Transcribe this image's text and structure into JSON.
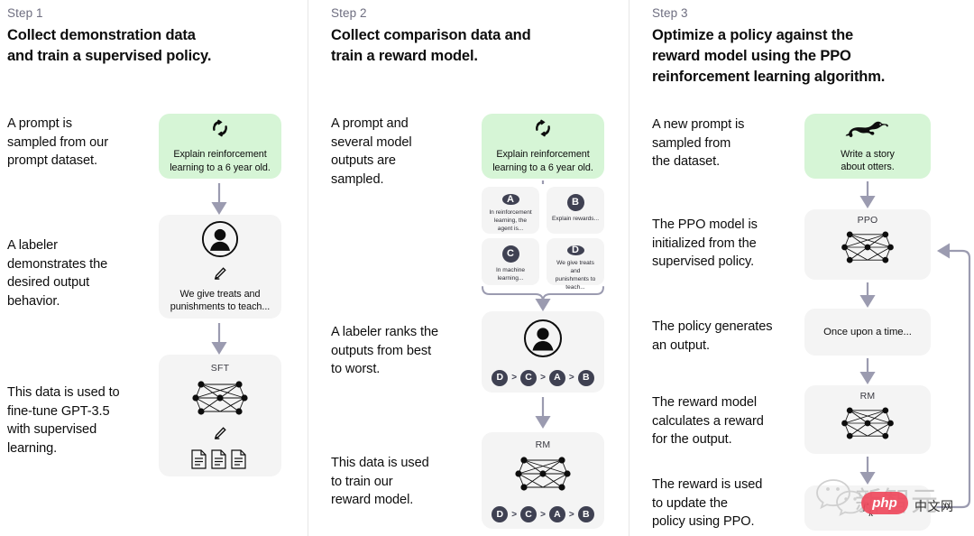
{
  "columns": [
    {
      "step_label": "Step 1",
      "title_lines": [
        "Collect demonstration data",
        "and train a supervised policy."
      ],
      "captions": [
        "A prompt is\nsampled from our\nprompt dataset.",
        "A labeler\ndemonstrates the\ndesired output\nbehavior.",
        "This data is used to\nfine-tune GPT-3.5\nwith supervised\nlearning."
      ],
      "cards": [
        {
          "name": "prompt-card",
          "icon": "refresh-cycle-icon",
          "text": "Explain reinforcement\nlearning to a 6 year old.",
          "style": "green"
        },
        {
          "name": "labeler-card",
          "icon": "person-circle-icon",
          "sub_icon": "pencil-icon",
          "text": "We give treats and\npunishments to teach...",
          "style": "gray"
        },
        {
          "name": "sft-card",
          "label": "SFT",
          "icon": "neural-network-icon",
          "sub_icon": "pencil-icon",
          "extra_icon": "documents-icon",
          "style": "gray"
        }
      ]
    },
    {
      "step_label": "Step 2",
      "title_lines": [
        "Collect comparison data and",
        "train a reward model."
      ],
      "captions": [
        "A prompt and\nseveral model\noutputs are\nsampled.",
        "A labeler ranks the\noutputs from best\nto worst.",
        "This data is used\nto train our\nreward model."
      ],
      "cards": [
        {
          "name": "prompt-card",
          "icon": "refresh-cycle-icon",
          "text": "Explain reinforcement\nlearning to a 6 year old.",
          "style": "green"
        },
        {
          "name": "ranking-card",
          "icon": "person-circle-icon",
          "style": "gray"
        },
        {
          "name": "rm-card",
          "label": "RM",
          "icon": "neural-network-icon",
          "style": "gray"
        }
      ],
      "outputs": [
        {
          "badge": "A",
          "text": "In reinforcement\nlearning, the\nagent is..."
        },
        {
          "badge": "B",
          "text": "Explain rewards..."
        },
        {
          "badge": "C",
          "text": "In machine\nlearning..."
        },
        {
          "badge": "D",
          "text": "We give treats and\npunishments to\nteach..."
        }
      ],
      "ranking": [
        "D",
        "C",
        "A",
        "B"
      ],
      "ranking_separator": ">"
    },
    {
      "step_label": "Step 3",
      "title_lines": [
        "Optimize a policy against the",
        "reward model using the PPO",
        "reinforcement learning algorithm."
      ],
      "captions": [
        "A new prompt is\nsampled from\nthe dataset.",
        "The PPO model is\ninitialized from the\nsupervised policy.",
        "The policy generates\nan output.",
        "The reward model\ncalculates a reward\nfor the output.",
        "The reward is used\nto update the\npolicy using PPO."
      ],
      "cards": [
        {
          "name": "new-prompt-card",
          "icon": "otter-icon",
          "text": "Write a story\nabout otters.",
          "style": "green"
        },
        {
          "name": "ppo-card",
          "label": "PPO",
          "icon": "neural-network-icon",
          "style": "gray"
        },
        {
          "name": "output-card",
          "text": "Once upon a time...",
          "style": "gray"
        },
        {
          "name": "rm-card",
          "label": "RM",
          "icon": "neural-network-icon",
          "style": "gray"
        },
        {
          "name": "reward-card",
          "text": "r",
          "subscript": "k",
          "style": "gray"
        }
      ]
    }
  ],
  "watermark": {
    "wechat_logo": "wechat-icon",
    "chinese_text": "新智元",
    "php_badge": "php",
    "site_text": "中文网"
  },
  "colors": {
    "green_card": "#d6f5d6",
    "gray_card": "#f4f4f4",
    "badge": "#3f4152",
    "arrow": "#9b9bb0",
    "divider": "#e6e6e6",
    "step_label": "#6e6e80",
    "php_badge": "#ef4a5e"
  }
}
